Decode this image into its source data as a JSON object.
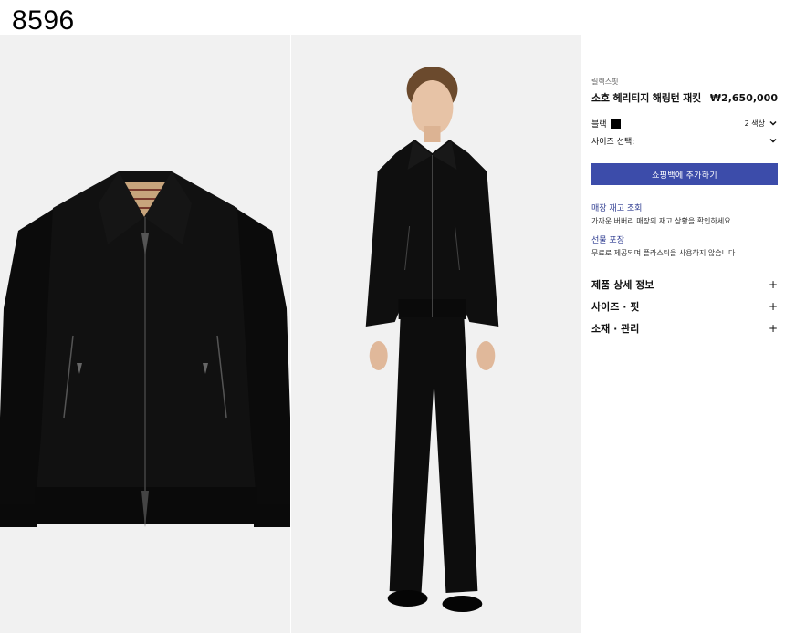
{
  "watermark": "8596",
  "product": {
    "category": "릴렉스핏",
    "name": "소호 헤리티지 해링턴 재킷",
    "price": "₩2,650,000",
    "color_label": "블랙",
    "color_hex": "#000000",
    "variants": "2 색상",
    "size_label": "사이즈 선택:",
    "add_to_bag": "쇼핑백에 추가하기"
  },
  "links": [
    {
      "title": "매장 재고 조회",
      "desc": "가까운 버버리 매장의 재고 상황을 확인하세요"
    },
    {
      "title": "선물 포장",
      "desc": "무료로 제공되며 플라스틱을 사용하지 않습니다"
    }
  ],
  "accordion": [
    {
      "label": "제품 상세 정보",
      "icon": "+"
    },
    {
      "label": "사이즈 · 핏",
      "icon": "+"
    },
    {
      "label": "소재 · 관리",
      "icon": "+"
    }
  ],
  "colors": {
    "accent": "#3c4caa",
    "link": "#2f3d91",
    "background": "#f1f1f1"
  }
}
